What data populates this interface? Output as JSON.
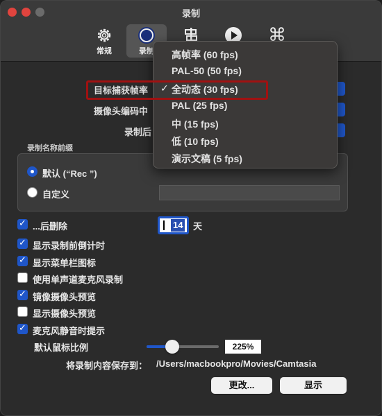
{
  "window": {
    "title": "录制"
  },
  "toolbar": {
    "tabs": [
      {
        "label": "常规",
        "icon": "gear-icon"
      },
      {
        "label": "录制",
        "icon": "record-icon"
      },
      {
        "label": "",
        "icon": "signpost-icon"
      },
      {
        "label": "",
        "icon": "play-icon"
      },
      {
        "label": "",
        "icon": "command-icon"
      }
    ]
  },
  "settings": {
    "target_fps_label": "目标捕获帧率",
    "camera_codec_label": "摄像头编码中",
    "after_record_label": "录制后"
  },
  "fps_menu": {
    "items": [
      {
        "label": "高帧率 (60 fps)",
        "checked": false
      },
      {
        "label": "PAL-50 (50 fps)",
        "checked": false
      },
      {
        "label": "全动态 (30 fps)",
        "checked": true
      },
      {
        "label": "PAL (25 fps)",
        "checked": false
      },
      {
        "label": "中 (15 fps)",
        "checked": false
      },
      {
        "label": "低 (10 fps)",
        "checked": false
      },
      {
        "label": "演示文稿 (5 fps)",
        "checked": false
      }
    ],
    "check_mark": "✓"
  },
  "name_prefix": {
    "title": "录制名称前缀",
    "default_option": "默认 (“Rec ”)",
    "custom_option": "自定义",
    "selected": "default"
  },
  "options": {
    "delete_after": {
      "label": "...后删除",
      "checked": true,
      "days": "14",
      "unit": "天"
    },
    "countdown": {
      "label": "显示录制前倒计时",
      "checked": true
    },
    "menubar_icon": {
      "label": "显示菜单栏图标",
      "checked": true
    },
    "mono_mic": {
      "label": "使用单声道麦克风录制",
      "checked": false
    },
    "mirror_camera": {
      "label": "镜像摄像头预览",
      "checked": true
    },
    "show_camera_preview": {
      "label": "显示摄像头预览",
      "checked": false
    },
    "mic_mute_hint": {
      "label": "麦克风静音时提示",
      "checked": true
    }
  },
  "cursor_scale": {
    "label": "默认鼠标比例",
    "value": "225%",
    "fraction": 0.3
  },
  "save_location": {
    "label": "将录制内容保存到：",
    "path": "/Users/macbookpro/Movies/Camtasia"
  },
  "buttons": {
    "change": "更改...",
    "show": "显示"
  },
  "colors": {
    "accent": "#1f56c9",
    "highlight_border": "#a11111"
  }
}
